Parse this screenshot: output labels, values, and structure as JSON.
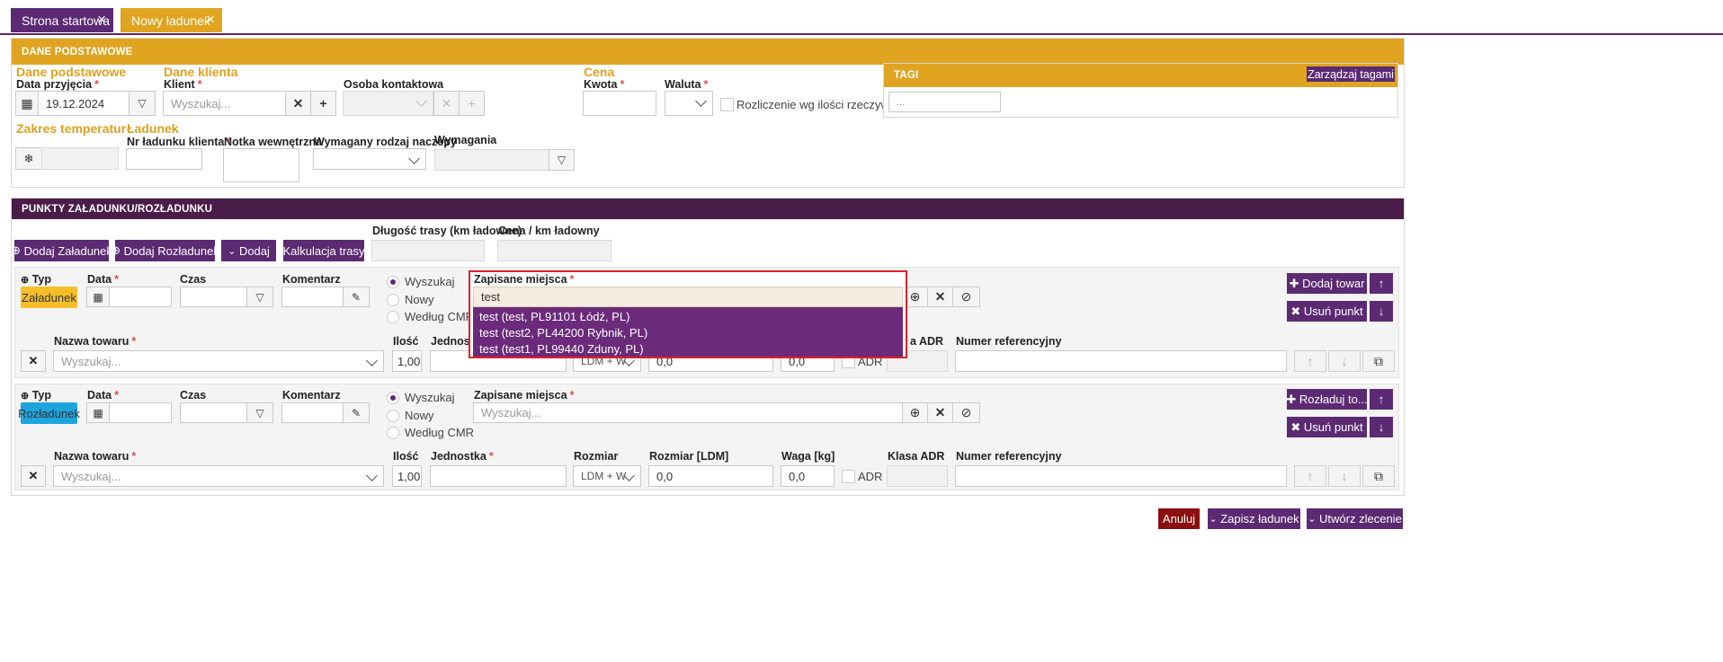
{
  "tabs": [
    {
      "label": "Strona startowa"
    },
    {
      "label": "Nowy ładunek"
    }
  ],
  "colors": {
    "accent": "#e0a420",
    "primary": "#5b2a73",
    "danger": "#8b0f0f"
  },
  "basic": {
    "header": "DANE PODSTAWOWE",
    "sec_basic": "Dane podstawowe",
    "date_label": "Data przyjęcia",
    "date_value": "19.12.2024",
    "sec_client": "Dane klienta",
    "client_label": "Klient",
    "client_placeholder": "Wyszukaj...",
    "contact_label": "Osoba kontaktowa",
    "sec_price": "Cena",
    "amount_label": "Kwota",
    "currency_label": "Waluta",
    "settle_label": "Rozliczenie wg ilości rzeczywistej",
    "tags_header": "TAGI",
    "tags_manage": "Zarządzaj tagami",
    "tags_placeholder": "...",
    "sec_temp": "Zakres temperatur",
    "temp_icon": "❄",
    "sec_load": "Ładunek",
    "client_no_label": "Nr ładunku klienta",
    "note_label": "Notka wewnętrzna",
    "trailer_label": "Wymagany rodzaj naczepy",
    "req_label": "Wymagania"
  },
  "points": {
    "header": "PUNKTY ZAŁADUNKU/ROZŁADUNKU",
    "btn_add_load": "Dodaj Załadunek",
    "btn_add_unload": "Dodaj Rozładunek",
    "btn_add": "Dodaj",
    "btn_calc": "Kalkulacja trasy",
    "route_len_label": "Długość trasy (km ładowne)",
    "price_km_label": "Cena / km ładowny",
    "rows": [
      {
        "type_label": "Typ",
        "type_value": "Załadunek",
        "date_label": "Data",
        "time_label": "Czas",
        "comment_label": "Komentarz",
        "radio_search": "Wyszukaj",
        "radio_new": "Nowy",
        "radio_cmr": "Według CMR",
        "places_label": "Zapisane miejsca",
        "places_value": "test",
        "btn_goods": "Dodaj towar",
        "btn_remove": "Usuń punkt",
        "goods_label": "Nazwa towaru",
        "goods_placeholder": "Wyszukaj...",
        "qty_label": "Ilość",
        "qty_value": "1,00",
        "unit_label": "Jednostka",
        "size_value": "LDM + W",
        "ldm_value": "0,0",
        "weight_value": "0,0",
        "adr_check": "ADR",
        "adr_label": "Klasa ADR",
        "ref_label": "Numer referencyjny"
      },
      {
        "type_label": "Typ",
        "type_value": "Rozładunek",
        "date_label": "Data",
        "time_label": "Czas",
        "comment_label": "Komentarz",
        "radio_search": "Wyszukaj",
        "radio_new": "Nowy",
        "radio_cmr": "Według CMR",
        "places_label": "Zapisane miejsca",
        "places_placeholder": "Wyszukaj...",
        "btn_goods": "Rozładuj to...",
        "btn_remove": "Usuń punkt",
        "goods_label": "Nazwa towaru",
        "goods_placeholder": "Wyszukaj...",
        "qty_label": "Ilość",
        "qty_value": "1,00",
        "unit_label": "Jednostka",
        "size_label": "Rozmiar",
        "size_value": "LDM + W",
        "ldm_label": "Rozmiar [LDM]",
        "ldm_value": "0,0",
        "weight_label": "Waga [kg]",
        "weight_value": "0,0",
        "adr_check": "ADR",
        "adr_label": "Klasa ADR",
        "ref_label": "Numer referencyjny"
      }
    ],
    "adr_label_partial": "a ADR",
    "dropdown": [
      "test (test, PL91101 Łódź, PL)",
      "test (test2, PL44200 Rybnik, PL)",
      "test (test1, PL99440 Zduny, PL)"
    ]
  },
  "footer": {
    "cancel": "Anuluj",
    "save": "Zapisz ładunek",
    "create": "Utwórz zlecenie"
  }
}
